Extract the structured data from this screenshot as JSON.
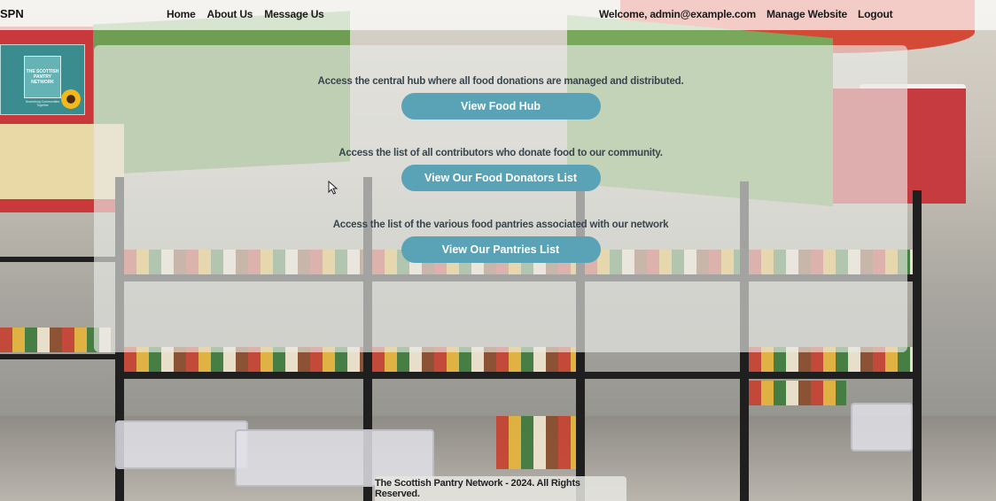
{
  "brand": "SPN",
  "nav": {
    "left": [
      "Home",
      "About Us",
      "Message Us"
    ],
    "welcome": "Welcome, admin@example.com",
    "right": [
      "Manage Website",
      "Logout"
    ]
  },
  "logo": {
    "text": "THE SCOTTISH PANTRY NETWORK",
    "tagline": "Nourishing Communities Together"
  },
  "sections": [
    {
      "description": "Access the central hub where all food donations are managed and distributed.",
      "button": "View Food Hub"
    },
    {
      "description": "Access the list of all contributors who donate food to our community.",
      "button": "View Our Food Donators List"
    },
    {
      "description": "Access the list of the various food pantries associated with our network",
      "button": "View Our Pantries List"
    }
  ],
  "footer": "The Scottish Pantry Network - 2024. All Rights Reserved.",
  "colors": {
    "button_bg": "#5aa2b6",
    "button_text": "#ffffff",
    "description_text": "#37454d",
    "panel_bg": "rgba(232,234,230,0.66)"
  }
}
